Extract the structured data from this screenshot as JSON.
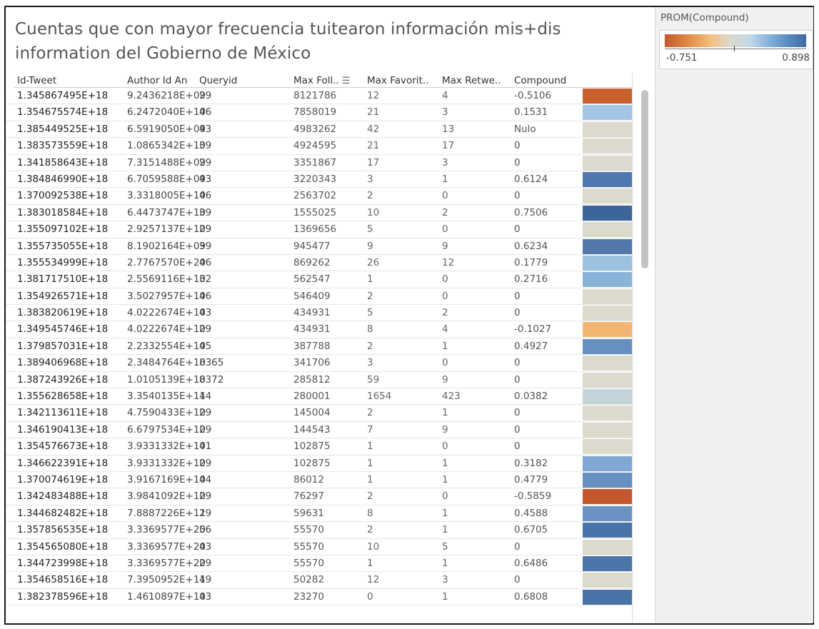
{
  "title": "Cuentas que con mayor frecuencia tuitearon información mis+dis information del Gobierno de México",
  "columns": {
    "id": "Id-Tweet",
    "author": "Author Id An",
    "query": "Queryid",
    "maxfoll": "Max Foll..",
    "fav": "Max Favorit..",
    "ret": "Max Retwe..",
    "comp": "Compound"
  },
  "legend": {
    "title": "PROM(Compound)",
    "min": "-0.751",
    "max": "0.898"
  },
  "colors": {
    "strong_neg": "#c5572c",
    "mid_neg": "#f3be7e",
    "neutral": "#dcd9cd",
    "light_pos": "#a5c5e3",
    "mid_pos": "#6e98c7",
    "strong_pos": "#3f6aa2"
  },
  "rows": [
    {
      "id": "1.345867495E+18",
      "author": "9.2436218E+09",
      "query": "29",
      "max": "8121786",
      "fav": "12",
      "ret": "4",
      "comp": "-0.5106",
      "color": "#c9612f"
    },
    {
      "id": "1.354675574E+18",
      "author": "6.2472040E+10",
      "query": "46",
      "max": "7858019",
      "fav": "21",
      "ret": "3",
      "comp": "0.1531",
      "color": "#a3c6e4"
    },
    {
      "id": "1.385449525E+18",
      "author": "6.5919050E+09",
      "query": "43",
      "max": "4983262",
      "fav": "42",
      "ret": "13",
      "comp": "Nulo",
      "color": "#dcd9cd"
    },
    {
      "id": "1.383573559E+18",
      "author": "1.0865342E+10",
      "query": "39",
      "max": "4924595",
      "fav": "21",
      "ret": "17",
      "comp": "0",
      "color": "#dcd9cd"
    },
    {
      "id": "1.341858643E+18",
      "author": "7.3151488E+09",
      "query": "29",
      "max": "3351867",
      "fav": "17",
      "ret": "3",
      "comp": "0",
      "color": "#dcd9cd"
    },
    {
      "id": "1.384846990E+18",
      "author": "6.7059588E+09",
      "query": "43",
      "max": "3220343",
      "fav": "3",
      "ret": "1",
      "comp": "0.6124",
      "color": "#4f79ae"
    },
    {
      "id": "1.370092538E+18",
      "author": "3.3318005E+10",
      "query": "46",
      "max": "2563702",
      "fav": "2",
      "ret": "0",
      "comp": "0",
      "color": "#dcd9cd"
    },
    {
      "id": "1.383018584E+18",
      "author": "6.4473747E+10",
      "query": "39",
      "max": "1555025",
      "fav": "10",
      "ret": "2",
      "comp": "0.7506",
      "color": "#3c6699"
    },
    {
      "id": "1.355097102E+18",
      "author": "2.9257137E+10",
      "query": "29",
      "max": "1369656",
      "fav": "5",
      "ret": "0",
      "comp": "0",
      "color": "#dcd9cd"
    },
    {
      "id": "1.355735055E+18",
      "author": "8.1902164E+09",
      "query": "39",
      "max": "945477",
      "fav": "9",
      "ret": "9",
      "comp": "0.6234",
      "color": "#5179ab"
    },
    {
      "id": "1.355534999E+18",
      "author": "2.7767570E+20",
      "query": "46",
      "max": "869262",
      "fav": "26",
      "ret": "12",
      "comp": "0.1779",
      "color": "#9cc2e2"
    },
    {
      "id": "1.381717510E+18",
      "author": "2.5569116E+10",
      "query": "32",
      "max": "562547",
      "fav": "1",
      "ret": "0",
      "comp": "0.2716",
      "color": "#8ab3d8"
    },
    {
      "id": "1.354926571E+18",
      "author": "3.5027957E+10",
      "query": "46",
      "max": "546409",
      "fav": "2",
      "ret": "0",
      "comp": "0",
      "color": "#dcd9cd"
    },
    {
      "id": "1.383820619E+18",
      "author": "4.0222674E+10",
      "query": "43",
      "max": "434931",
      "fav": "5",
      "ret": "2",
      "comp": "0",
      "color": "#dcd9cd"
    },
    {
      "id": "1.349545746E+18",
      "author": "4.0222674E+10",
      "query": "29",
      "max": "434931",
      "fav": "8",
      "ret": "4",
      "comp": "-0.1027",
      "color": "#f3b672"
    },
    {
      "id": "1.379857031E+18",
      "author": "2.2332554E+10",
      "query": "45",
      "max": "387788",
      "fav": "2",
      "ret": "1",
      "comp": "0.4927",
      "color": "#6690c2"
    },
    {
      "id": "1.389406968E+18",
      "author": "2.3484764E+10",
      "query": "8365",
      "max": "341706",
      "fav": "3",
      "ret": "0",
      "comp": "0",
      "color": "#dcd9cd"
    },
    {
      "id": "1.387243926E+18",
      "author": "1.0105139E+10",
      "query": "8372",
      "max": "285812",
      "fav": "59",
      "ret": "9",
      "comp": "0",
      "color": "#dcd9cd"
    },
    {
      "id": "1.355628658E+18",
      "author": "3.3540135E+11",
      "query": "44",
      "max": "280001",
      "fav": "1654",
      "ret": "423",
      "comp": "0.0382",
      "color": "#c4d2da"
    },
    {
      "id": "1.342113611E+18",
      "author": "4.7590433E+10",
      "query": "29",
      "max": "145004",
      "fav": "2",
      "ret": "1",
      "comp": "0",
      "color": "#dcd9cd"
    },
    {
      "id": "1.346190413E+18",
      "author": "6.6797534E+10",
      "query": "29",
      "max": "144543",
      "fav": "7",
      "ret": "9",
      "comp": "0",
      "color": "#dcd9cd"
    },
    {
      "id": "1.354576673E+18",
      "author": "3.9331332E+10",
      "query": "41",
      "max": "102875",
      "fav": "1",
      "ret": "0",
      "comp": "0",
      "color": "#dcd9cd"
    },
    {
      "id": "1.346622391E+18",
      "author": "3.9331332E+10",
      "query": "29",
      "max": "102875",
      "fav": "1",
      "ret": "1",
      "comp": "0.3182",
      "color": "#7fa9d2"
    },
    {
      "id": "1.370074619E+18",
      "author": "3.9167169E+10",
      "query": "44",
      "max": "86012",
      "fav": "1",
      "ret": "1",
      "comp": "0.4779",
      "color": "#6690c2"
    },
    {
      "id": "1.342483488E+18",
      "author": "3.9841092E+10",
      "query": "29",
      "max": "76297",
      "fav": "2",
      "ret": "0",
      "comp": "-0.5859",
      "color": "#c5572c"
    },
    {
      "id": "1.344682482E+18",
      "author": "7.8887226E+11",
      "query": "29",
      "max": "59631",
      "fav": "8",
      "ret": "1",
      "comp": "0.4588",
      "color": "#6a93c4"
    },
    {
      "id": "1.357856535E+18",
      "author": "3.3369577E+20",
      "query": "56",
      "max": "55570",
      "fav": "2",
      "ret": "1",
      "comp": "0.6705",
      "color": "#4a73a8"
    },
    {
      "id": "1.354565080E+18",
      "author": "3.3369577E+20",
      "query": "43",
      "max": "55570",
      "fav": "10",
      "ret": "5",
      "comp": "0",
      "color": "#dcd9cd"
    },
    {
      "id": "1.344723998E+18",
      "author": "3.3369577E+20",
      "query": "29",
      "max": "55570",
      "fav": "1",
      "ret": "1",
      "comp": "0.6486",
      "color": "#4c76aa"
    },
    {
      "id": "1.354658516E+18",
      "author": "7.3950952E+11",
      "query": "49",
      "max": "50282",
      "fav": "12",
      "ret": "3",
      "comp": "0",
      "color": "#dcd9cd"
    },
    {
      "id": "1.382378596E+18",
      "author": "1.4610897E+10",
      "query": "43",
      "max": "23270",
      "fav": "0",
      "ret": "1",
      "comp": "0.6808",
      "color": "#4a73a8"
    }
  ]
}
